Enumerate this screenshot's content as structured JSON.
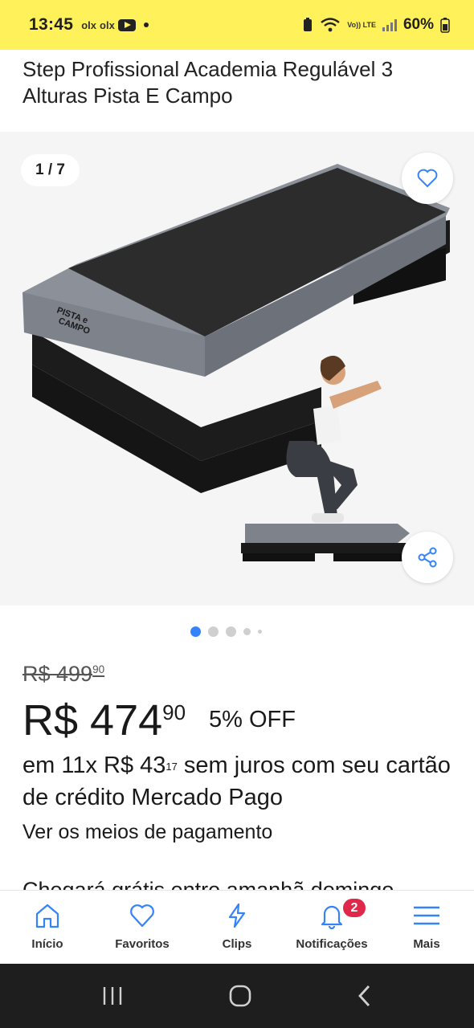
{
  "status": {
    "time": "13:45",
    "apps": [
      "olx",
      "olx"
    ],
    "lte": "Vo))\nLTE",
    "battery": "60%"
  },
  "product": {
    "title": "Step Profissional Academia Regulável 3 Alturas Pista E Campo",
    "gallery_counter": "1 / 7",
    "brand_on_image": "PISTA e CAMPO",
    "images_total": 7,
    "current_image": 1
  },
  "pricing": {
    "old_price_main": "R$ 499",
    "old_price_cents": "90",
    "price_main": "R$ 474",
    "price_cents": "90",
    "discount": "5% OFF",
    "installment_prefix": "em 11x R$ 43",
    "installment_cents": "17",
    "installment_suffix": " sem juros com seu cartão de crédito Mercado Pago",
    "payment_link": "Ver os meios de pagamento",
    "shipping": "Chegará grátis entre amanhã domingo"
  },
  "tabbar": {
    "items": [
      {
        "label": "Início",
        "icon": "home-icon"
      },
      {
        "label": "Favoritos",
        "icon": "heart-icon"
      },
      {
        "label": "Clips",
        "icon": "bolt-icon"
      },
      {
        "label": "Notificações",
        "icon": "bell-icon",
        "badge": "2"
      },
      {
        "label": "Mais",
        "icon": "menu-icon"
      }
    ]
  },
  "colors": {
    "statusbar": "#fff159",
    "accent": "#3483fa",
    "badge": "#e0284b"
  }
}
